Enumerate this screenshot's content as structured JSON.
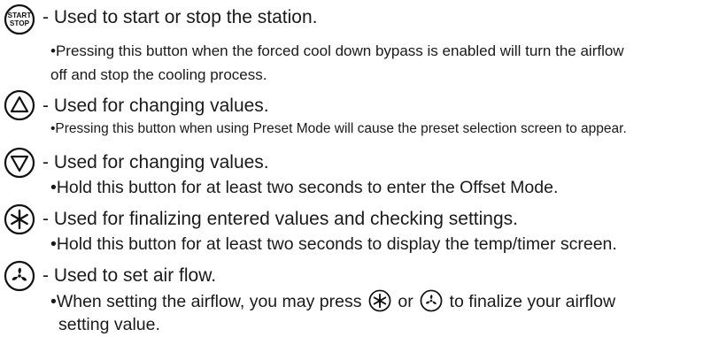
{
  "buttons": [
    {
      "icon": "start-stop-button-icon",
      "icon_text_line1": "START",
      "icon_text_line2": "STOP",
      "description": "- Used to start or stop the station.",
      "note_line1": "•Pressing this button when the forced cool down bypass is enabled will turn the airflow",
      "note_line2": "off and stop the cooling process."
    },
    {
      "icon": "up-triangle-button-icon",
      "description": "- Used for changing values.",
      "note_line1": "•Pressing this button when using Preset Mode will cause the preset selection screen to appear."
    },
    {
      "icon": "down-triangle-button-icon",
      "description": "- Used for changing values.",
      "note_line1": "•Hold this button for at least two seconds to enter the Offset Mode."
    },
    {
      "icon": "asterisk-button-icon",
      "description": "- Used for finalizing entered values and checking settings.",
      "note_line1": "•Hold this button for at least two seconds to display the temp/timer screen."
    },
    {
      "icon": "fan-button-icon",
      "description": "- Used to set air flow.",
      "note_line1_part1": "•When setting the airflow, you may press",
      "note_line1_part2": "or",
      "note_line1_part3": "to finalize your airflow",
      "note_line2": "setting value."
    }
  ]
}
